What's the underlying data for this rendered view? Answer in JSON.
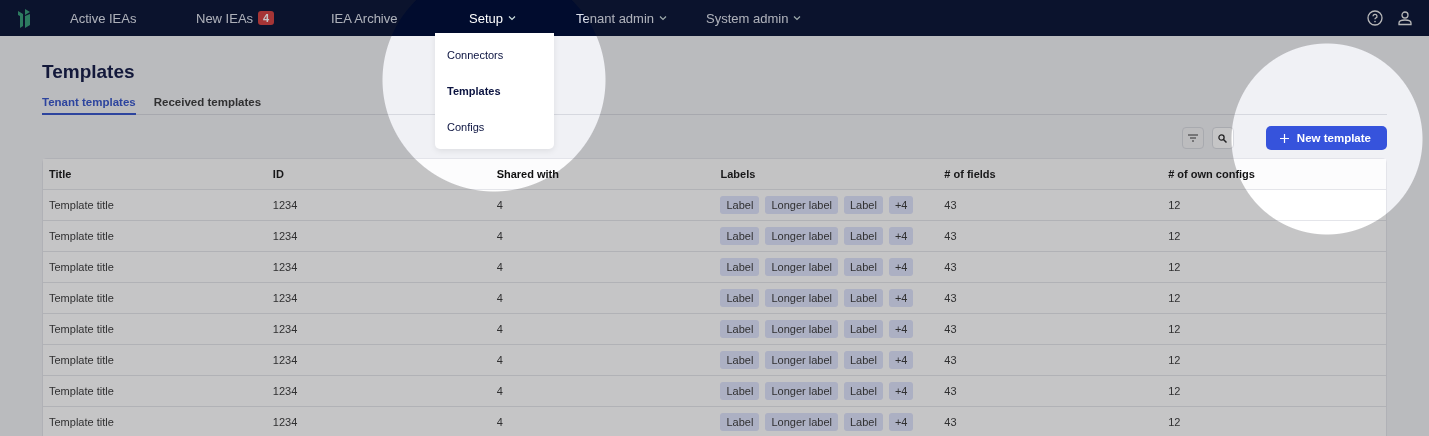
{
  "nav": {
    "items": [
      {
        "label": "Active IEAs",
        "selected": false,
        "dropdown": false
      },
      {
        "label": "New IEAs",
        "selected": false,
        "dropdown": false,
        "badge": "4"
      },
      {
        "label": "IEA Archive",
        "selected": false,
        "dropdown": false
      },
      {
        "label": "Setup",
        "selected": true,
        "dropdown": true
      },
      {
        "label": "Tenant admin",
        "selected": false,
        "dropdown": true
      },
      {
        "label": "System admin",
        "selected": false,
        "dropdown": true
      }
    ]
  },
  "setup_menu": {
    "items": [
      {
        "label": "Connectors",
        "selected": false
      },
      {
        "label": "Templates",
        "selected": true
      },
      {
        "label": "Configs",
        "selected": false
      }
    ]
  },
  "page": {
    "title": "Templates",
    "tabs": [
      {
        "label": "Tenant templates",
        "selected": true
      },
      {
        "label": "Received templates",
        "selected": false
      }
    ],
    "new_button": "New template"
  },
  "table": {
    "columns": [
      "Title",
      "ID",
      "Shared with",
      "Labels",
      "# of fields",
      "# of own configs"
    ],
    "rows": [
      {
        "title": "Template title",
        "id": "1234",
        "shared_with": "4",
        "labels": [
          "Label",
          "Longer label",
          "Label",
          "+4"
        ],
        "fields": "43",
        "own_configs": "12"
      },
      {
        "title": "Template title",
        "id": "1234",
        "shared_with": "4",
        "labels": [
          "Label",
          "Longer label",
          "Label",
          "+4"
        ],
        "fields": "43",
        "own_configs": "12"
      },
      {
        "title": "Template title",
        "id": "1234",
        "shared_with": "4",
        "labels": [
          "Label",
          "Longer label",
          "Label",
          "+4"
        ],
        "fields": "43",
        "own_configs": "12"
      },
      {
        "title": "Template title",
        "id": "1234",
        "shared_with": "4",
        "labels": [
          "Label",
          "Longer label",
          "Label",
          "+4"
        ],
        "fields": "43",
        "own_configs": "12"
      },
      {
        "title": "Template title",
        "id": "1234",
        "shared_with": "4",
        "labels": [
          "Label",
          "Longer label",
          "Label",
          "+4"
        ],
        "fields": "43",
        "own_configs": "12"
      },
      {
        "title": "Template title",
        "id": "1234",
        "shared_with": "4",
        "labels": [
          "Label",
          "Longer label",
          "Label",
          "+4"
        ],
        "fields": "43",
        "own_configs": "12"
      },
      {
        "title": "Template title",
        "id": "1234",
        "shared_with": "4",
        "labels": [
          "Label",
          "Longer label",
          "Label",
          "+4"
        ],
        "fields": "43",
        "own_configs": "12"
      },
      {
        "title": "Template title",
        "id": "1234",
        "shared_with": "4",
        "labels": [
          "Label",
          "Longer label",
          "Label",
          "+4"
        ],
        "fields": "43",
        "own_configs": "12"
      }
    ]
  }
}
